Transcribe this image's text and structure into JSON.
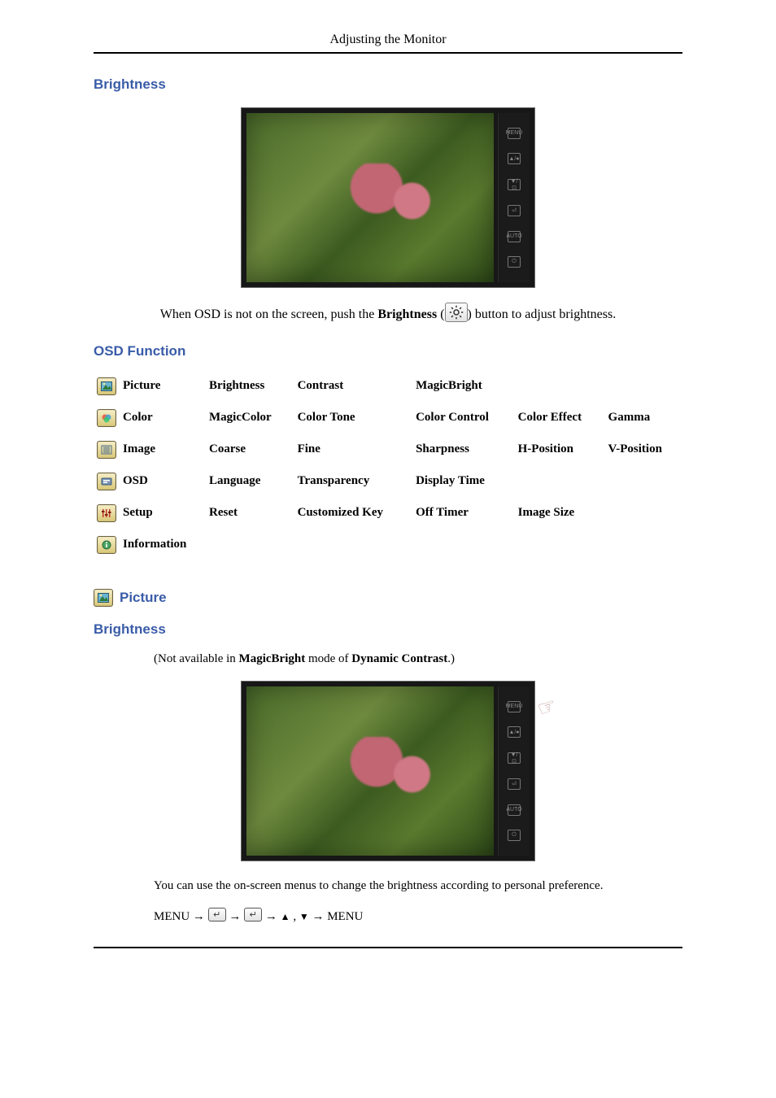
{
  "header": {
    "title": "Adjusting the Monitor"
  },
  "sections": {
    "brightness1": {
      "heading": "Brightness",
      "text_pre": "When OSD is not on the screen, push the ",
      "text_bold": "Brightness",
      "text_paren_open": " (",
      "text_paren_close": ") button to adjust brightness."
    },
    "osd_function": {
      "heading": "OSD Function",
      "rows": [
        {
          "label": "Picture",
          "items": [
            "Brightness",
            "Contrast",
            "MagicBright",
            "",
            ""
          ]
        },
        {
          "label": "Color",
          "items": [
            "MagicColor",
            "Color Tone",
            "Color Control",
            "Color Effect",
            "Gamma"
          ]
        },
        {
          "label": "Image",
          "items": [
            "Coarse",
            "Fine",
            "Sharpness",
            "H-Position",
            "V-Position"
          ]
        },
        {
          "label": "OSD",
          "items": [
            "Language",
            "Transparency",
            "Display Time",
            "",
            ""
          ]
        },
        {
          "label": "Setup",
          "items": [
            "Reset",
            "Customized Key",
            "Off Timer",
            "Image Size",
            ""
          ]
        },
        {
          "label": "Information",
          "items": [
            "",
            "",
            "",
            "",
            ""
          ]
        }
      ]
    },
    "picture": {
      "heading": "Picture"
    },
    "brightness2": {
      "heading": "Brightness",
      "note_pre": "(Not available in ",
      "note_b1": "MagicBright ",
      "note_mid": " mode of ",
      "note_b2": "Dynamic Contrast",
      "note_post": ".)",
      "desc": "You can use the on-screen menus to change the brightness according to personal preference.",
      "seq": {
        "menu": "MENU",
        "arrow": " → ",
        "updown_sep": " , ",
        "final": " → MENU"
      }
    }
  },
  "monitor_buttons": [
    "MENU",
    "▲/●",
    "▼/⊡",
    "⏎",
    "AUTO",
    "⏻"
  ]
}
